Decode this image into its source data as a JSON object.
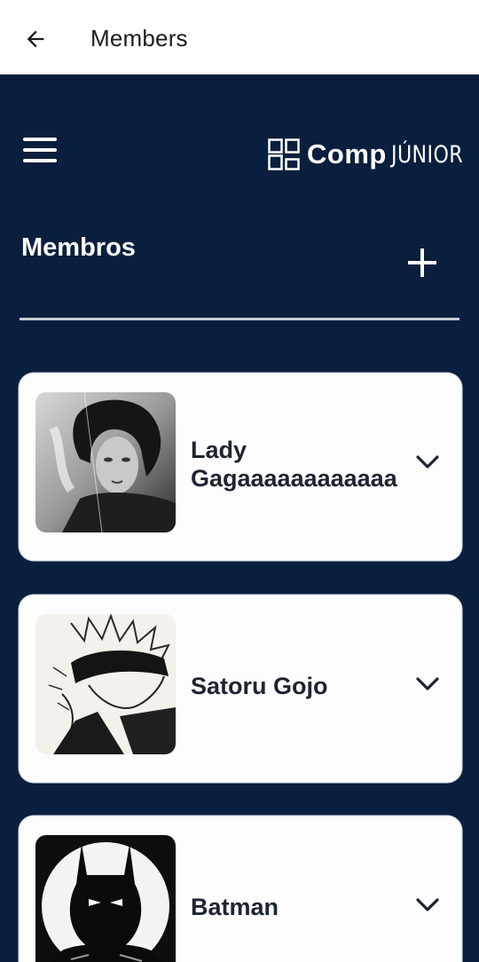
{
  "appbar": {
    "title": "Members",
    "back_icon": "arrow-left-icon"
  },
  "header": {
    "menu_icon": "hamburger-menu-icon",
    "logo": {
      "comp": "Comp",
      "junior": "JÚNIOR"
    }
  },
  "section": {
    "title": "Membros",
    "add_icon": "plus-icon"
  },
  "members": [
    {
      "name": "Lady Gagaaaaaaaaaaaa",
      "photo": "portrait-photo-bw",
      "expand_icon": "chevron-down-icon"
    },
    {
      "name": "Satoru Gojo",
      "photo": "anime-sketch-illustration",
      "expand_icon": "chevron-down-icon"
    },
    {
      "name": "Batman",
      "photo": "batman-illustration",
      "expand_icon": "chevron-down-icon"
    }
  ],
  "colors": {
    "background": "#0a1f3d",
    "card": "#fdfdfd",
    "appbar": "#ffffff",
    "text_dark": "#1d2433"
  }
}
